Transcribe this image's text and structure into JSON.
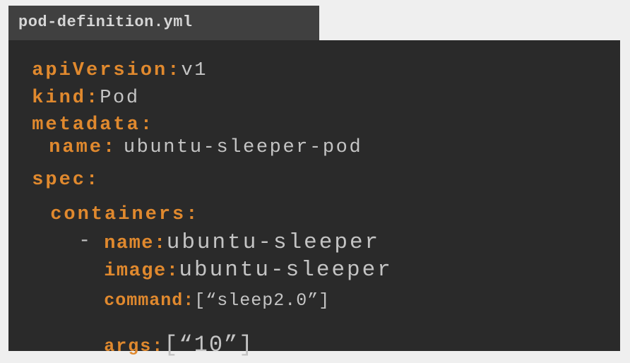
{
  "tab": {
    "filename": "pod-definition.yml"
  },
  "yaml": {
    "apiVersion": {
      "key": "apiVersion:",
      "value": "v1"
    },
    "kind": {
      "key": "kind:",
      "value": "Pod"
    },
    "metadata": {
      "key": "metadata:"
    },
    "metadata_name": {
      "key": "name:",
      "value": "ubuntu-sleeper-pod"
    },
    "spec": {
      "key": "spec:"
    },
    "containers": {
      "key": "containers:"
    },
    "dash": "-",
    "container_name": {
      "key": "name:",
      "value": "ubuntu-sleeper"
    },
    "image": {
      "key": "image:",
      "value": "ubuntu-sleeper"
    },
    "command": {
      "key": "command:",
      "value": "[“sleep2.0”]"
    },
    "args": {
      "key": "args:",
      "value": "[“10”]"
    }
  },
  "colors": {
    "key": "#e0892e",
    "value": "#c4c4c4",
    "panel": "#2a2a2a",
    "tab": "#404040"
  }
}
